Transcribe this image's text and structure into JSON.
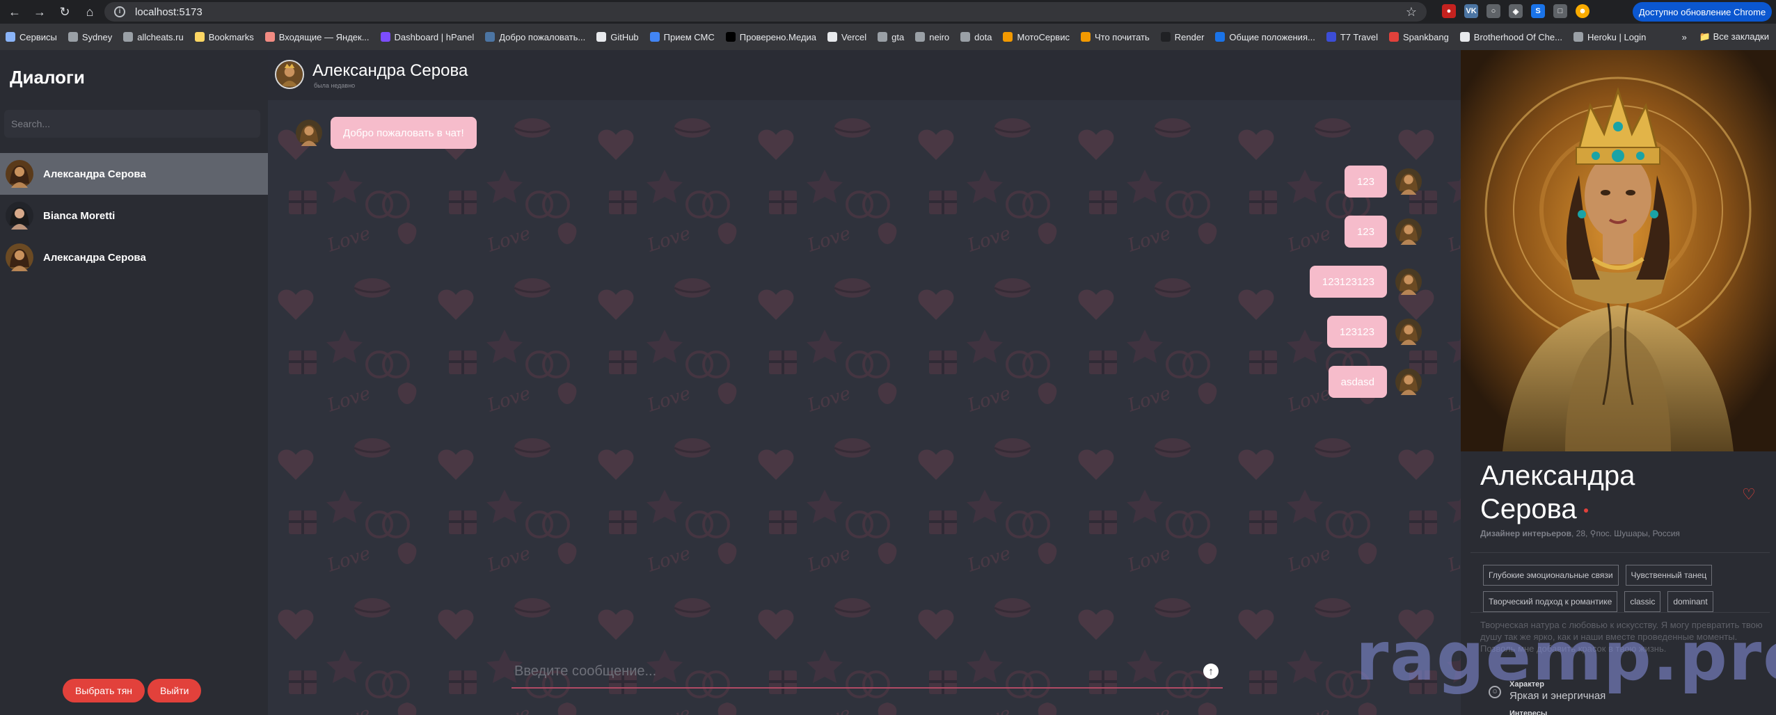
{
  "browser": {
    "url": "localhost:5173",
    "update_label": "Доступно обновление Chrome",
    "bookmarks": [
      {
        "label": "Сервисы",
        "color": "#8ab4f8"
      },
      {
        "label": "Sydney",
        "color": "#9aa0a6"
      },
      {
        "label": "allcheats.ru",
        "color": "#9aa0a6"
      },
      {
        "label": "Bookmarks",
        "color": "#fdd663"
      },
      {
        "label": "Входящие — Яндек...",
        "color": "#f28b82"
      },
      {
        "label": "Dashboard | hPanel",
        "color": "#7c4dff"
      },
      {
        "label": "Добро пожаловать...",
        "color": "#4c75a3"
      },
      {
        "label": "GitHub",
        "color": "#e8eaed"
      },
      {
        "label": "Прием СМС",
        "color": "#4285f4"
      },
      {
        "label": "Проверено.Медиа",
        "color": "#000000"
      },
      {
        "label": "Vercel",
        "color": "#e8eaed"
      },
      {
        "label": "gta",
        "color": "#9aa0a6"
      },
      {
        "label": "neiro",
        "color": "#9aa0a6"
      },
      {
        "label": "dota",
        "color": "#9aa0a6"
      },
      {
        "label": "МотоСервис",
        "color": "#f29900"
      },
      {
        "label": "Что почитать",
        "color": "#f29900"
      },
      {
        "label": "Render",
        "color": "#202124"
      },
      {
        "label": "Общие положения...",
        "color": "#1a73e8"
      },
      {
        "label": "T7 Travel",
        "color": "#3c4dd6"
      },
      {
        "label": "Spankbang",
        "color": "#e2413b"
      },
      {
        "label": "Brotherhood Of Che...",
        "color": "#e8eaed"
      },
      {
        "label": "Heroku | Login",
        "color": "#9aa0a6"
      }
    ],
    "more_label": "»",
    "all_bookmarks_label": "Все закладки"
  },
  "sidebar": {
    "title": "Диалоги",
    "search_placeholder": "Search...",
    "dialogs": [
      {
        "name": "Александра Серова",
        "active": true
      },
      {
        "name": "Bianca Moretti",
        "active": false
      },
      {
        "name": "Александра Серова",
        "active": false
      }
    ],
    "choose_label": "Выбрать тян",
    "logout_label": "Выйти"
  },
  "chat": {
    "header_name": "Александра Серова",
    "header_status": "была недавно",
    "messages": [
      {
        "text": "Добро пожаловать в чат!",
        "from": "bot"
      },
      {
        "text": "123",
        "from": "me"
      },
      {
        "text": "123",
        "from": "me"
      },
      {
        "text": "123123123",
        "from": "me"
      },
      {
        "text": "123123",
        "from": "me"
      },
      {
        "text": "asdasd",
        "from": "me"
      }
    ],
    "input_placeholder": "Введите сообщение...",
    "send_icon": "arrow-up-circle-icon"
  },
  "profile": {
    "name": "Александра Серова",
    "job": "Дизайнер интерьеров",
    "age": "28",
    "location": "пос. Шушары, Россия",
    "tags": [
      "Глубокие эмоциональные связи",
      "Чувственный танец",
      "Творческий подход к романтике",
      "classic",
      "dominant"
    ],
    "bio": "Творческая натура с любовью к искусству. Я могу превратить твою душу так же ярко, как и наши вместе проведенные моменты. Позволь мне добавить красок в твою жизнь.",
    "character_label": "Характер",
    "character_value": "Яркая и энергичная",
    "interests_label": "Интересы"
  },
  "watermark": "ragemp.pro",
  "colors": {
    "accent": "#e2413b",
    "bubble": "#f6bccb",
    "chat_bg": "#2f323c",
    "sidebar_bg": "#2a2c33",
    "active_dialog": "#60646d"
  }
}
